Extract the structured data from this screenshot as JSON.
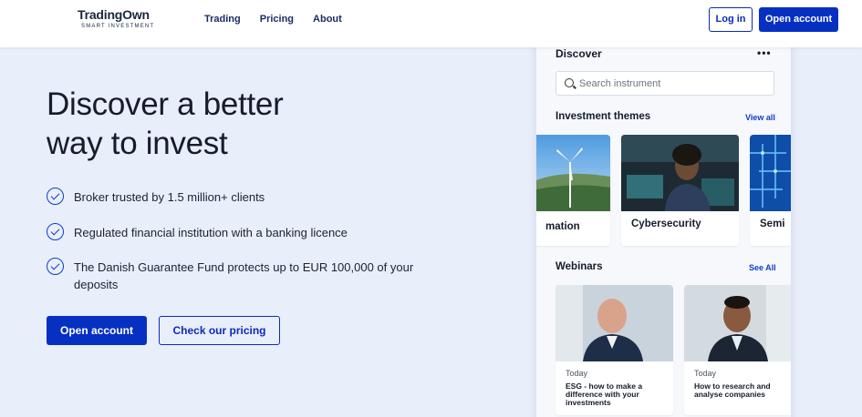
{
  "header": {
    "logo_name": "TradingOwn",
    "logo_tagline": "SMART INVESTMENT",
    "nav": [
      {
        "label": "Trading"
      },
      {
        "label": "Pricing"
      },
      {
        "label": "About"
      }
    ],
    "login_label": "Log in",
    "open_account_label": "Open account"
  },
  "hero": {
    "title_line1": "Discover a better",
    "title_line2": "way to invest",
    "features": [
      {
        "text": "Broker trusted by 1.5 million+ clients"
      },
      {
        "text": "Regulated financial institution with a banking licence"
      },
      {
        "text": "The Danish Guarantee Fund protects up to EUR 100,000 of your deposits"
      }
    ],
    "open_account_label": "Open account",
    "pricing_label": "Check our pricing"
  },
  "panel": {
    "title": "Discover",
    "menu_icon": "•••",
    "search_placeholder": "Search instrument",
    "themes_title": "Investment themes",
    "themes_view_all": "View all",
    "themes": [
      {
        "label": "mation"
      },
      {
        "label": "Cybersecurity"
      },
      {
        "label": "Semi"
      }
    ],
    "webinars_title": "Webinars",
    "webinars_view_all": "See All",
    "webinars": [
      {
        "date": "Today",
        "title": "ESG - how to make a difference with your investments"
      },
      {
        "date": "Today",
        "title": "How to research and analyse companies"
      }
    ]
  },
  "colors": {
    "accent": "#0630c2",
    "page_background": "#e9eefb"
  }
}
